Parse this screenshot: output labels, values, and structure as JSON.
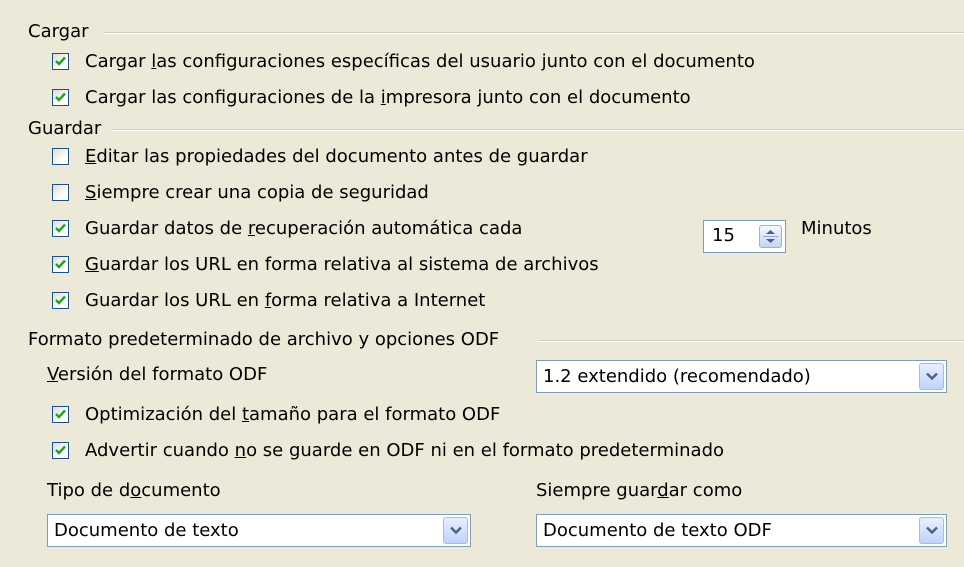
{
  "cargar": {
    "title": "Cargar",
    "options": [
      {
        "pre": "Cargar ",
        "key": "l",
        "post": "as configuraciones específicas del usuario junto con el documento",
        "checked": true
      },
      {
        "pre": "Cargar las configuraciones de la ",
        "key": "i",
        "post": "mpresora junto con el documento",
        "checked": true
      }
    ]
  },
  "guardar": {
    "title": "Guardar",
    "options": [
      {
        "pre": "",
        "key": "E",
        "post": "ditar las propiedades del documento antes de guardar",
        "checked": false
      },
      {
        "pre": "",
        "key": "S",
        "post": "iempre crear una copia de seguridad",
        "checked": false
      },
      {
        "pre": "Guardar datos de ",
        "key": "r",
        "post": "ecuperación automática cada",
        "checked": true
      },
      {
        "pre": "",
        "key": "G",
        "post": "uardar los URL en forma relativa al sistema de archivos",
        "checked": true
      },
      {
        "pre": "Guardar los URL en ",
        "key": "f",
        "post": "orma relativa a Internet",
        "checked": true
      }
    ],
    "autorecovery_minutes": "15",
    "minutes_label": "Minutos"
  },
  "odf": {
    "title": "Formato predeterminado de archivo y opciones ODF",
    "version_label": {
      "pre": "",
      "key": "V",
      "post": "ersión del formato ODF"
    },
    "version_value": "1.2 extendido (recomendado)",
    "options": [
      {
        "pre": "Optimización del ",
        "key": "t",
        "post": "amaño para el formato ODF",
        "checked": true
      },
      {
        "pre": "Advertir cuando ",
        "key": "n",
        "post": "o se guarde en ODF ni en el formato predeterminado",
        "checked": true
      }
    ],
    "doc_type_label": {
      "pre": "Tipo de d",
      "key": "o",
      "post": "cumento"
    },
    "doc_type_value": "Documento de texto",
    "save_as_label": {
      "pre": "Siempre guar",
      "key": "d",
      "post": "ar como"
    },
    "save_as_value": "Documento de texto ODF"
  }
}
